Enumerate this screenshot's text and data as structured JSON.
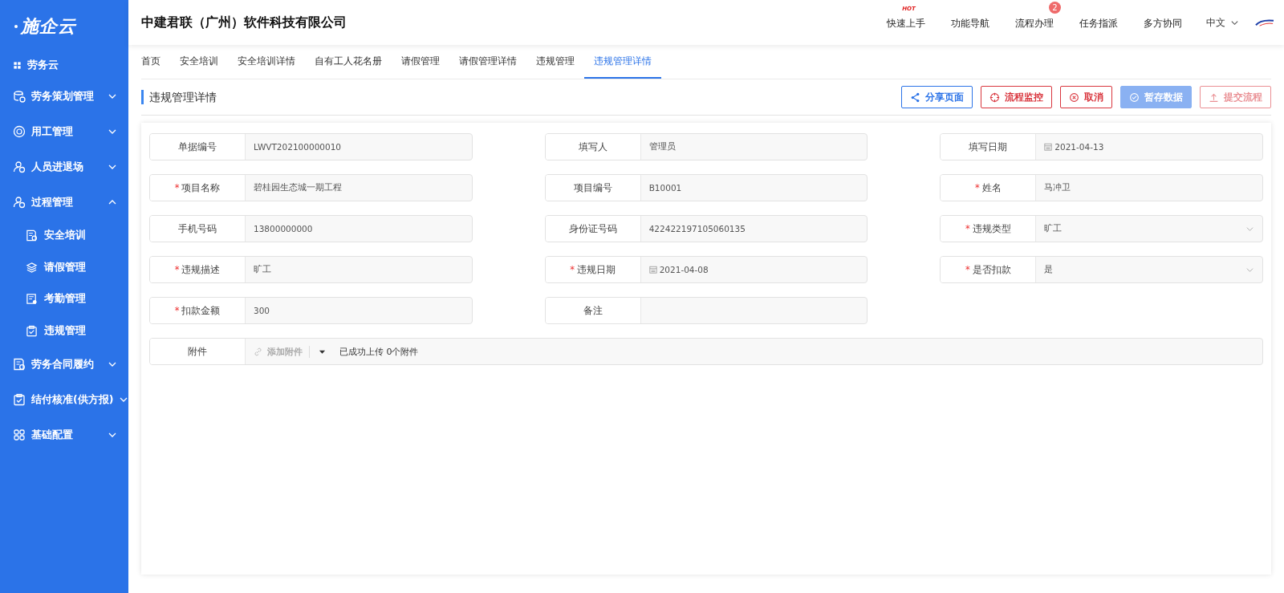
{
  "sidebar": {
    "logo": "施企云",
    "items": [
      {
        "label": "劳务云",
        "kind": "header"
      },
      {
        "label": "劳务策划管理",
        "kind": "group",
        "expanded": false
      },
      {
        "label": "用工管理",
        "kind": "group",
        "expanded": false
      },
      {
        "label": "人员进退场",
        "kind": "group",
        "expanded": false
      },
      {
        "label": "过程管理",
        "kind": "group",
        "expanded": true,
        "children": [
          {
            "label": "安全培训"
          },
          {
            "label": "请假管理"
          },
          {
            "label": "考勤管理"
          },
          {
            "label": "违规管理"
          }
        ]
      },
      {
        "label": "劳务合同履约",
        "kind": "group",
        "expanded": false
      },
      {
        "label": "结付核准(供方报)",
        "kind": "group",
        "expanded": false
      },
      {
        "label": "基础配置",
        "kind": "group",
        "expanded": false
      }
    ]
  },
  "header": {
    "company": "中建君联（广州）软件科技有限公司",
    "nav": [
      {
        "label": "快速上手",
        "hot": "HOT"
      },
      {
        "label": "功能导航"
      },
      {
        "label": "流程办理",
        "count": "2"
      },
      {
        "label": "任务指派"
      },
      {
        "label": "多方协同"
      }
    ],
    "language": "中文"
  },
  "tabs": [
    {
      "label": "首页",
      "selected": false
    },
    {
      "label": "安全培训",
      "selected": false
    },
    {
      "label": "安全培训详情",
      "selected": false
    },
    {
      "label": "自有工人花名册",
      "selected": false
    },
    {
      "label": "请假管理",
      "selected": false
    },
    {
      "label": "请假管理详情",
      "selected": false
    },
    {
      "label": "违规管理",
      "selected": false
    },
    {
      "label": "违规管理详情",
      "selected": true
    }
  ],
  "page_title": "违规管理详情",
  "actions": [
    {
      "label": "分享页面",
      "kind": "share",
      "disabled": false
    },
    {
      "label": "流程监控",
      "kind": "monitor",
      "disabled": false
    },
    {
      "label": "取消",
      "kind": "cancel",
      "disabled": false
    },
    {
      "label": "暂存数据",
      "kind": "save",
      "disabled": true
    },
    {
      "label": "提交流程",
      "kind": "submit",
      "disabled": true
    }
  ],
  "fields": [
    {
      "label": "单据编号",
      "value": "LWVT202100000010",
      "kind": "text"
    },
    {
      "label": "填写人",
      "value": "管理员",
      "kind": "text"
    },
    {
      "label": "填写日期",
      "value": "2021-04-13",
      "kind": "date"
    },
    {
      "label": "项目名称",
      "value": "碧桂园生态城一期工程",
      "kind": "text",
      "required_mark": "*"
    },
    {
      "label": "项目编号",
      "value": "B10001",
      "kind": "text"
    },
    {
      "label": "姓名",
      "value": "马冲卫",
      "kind": "text",
      "required_mark": "*"
    },
    {
      "label": "手机号码",
      "value": "13800000000",
      "kind": "text"
    },
    {
      "label": "身份证号码",
      "value": "422422197105060135",
      "kind": "text"
    },
    {
      "label": "违规类型",
      "value": "旷工",
      "kind": "select",
      "required_mark": "*"
    },
    {
      "label": "违规描述",
      "value": "旷工",
      "kind": "text",
      "required_mark": "*"
    },
    {
      "label": "违规日期",
      "value": "2021-04-08",
      "kind": "date",
      "required_mark": "*"
    },
    {
      "label": "是否扣款",
      "value": "是",
      "kind": "select",
      "required_mark": "*"
    },
    {
      "label": "扣款金额",
      "value": "300",
      "kind": "text",
      "required_mark": "*"
    },
    {
      "label": "备注",
      "kind": "text"
    }
  ],
  "attachment": {
    "label": "附件",
    "button": "添加附件",
    "status": "已成功上传 0个附件"
  }
}
